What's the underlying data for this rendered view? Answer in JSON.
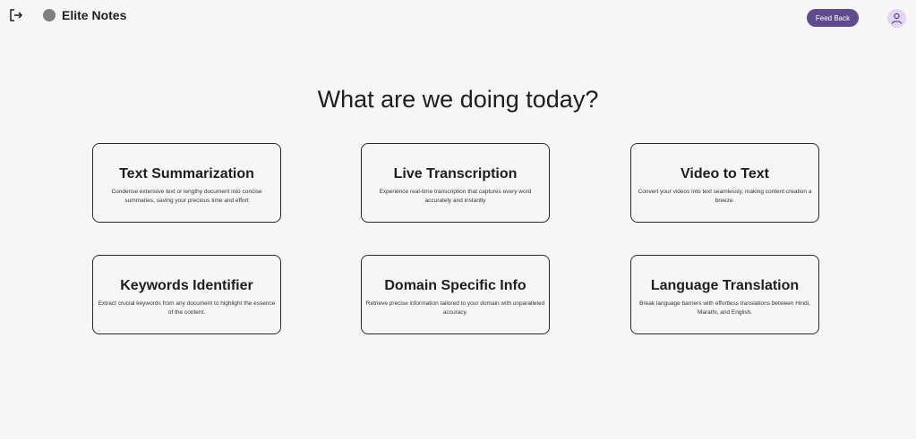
{
  "header": {
    "app_title": "Elite Notes",
    "feedback_label": "Feed Back",
    "logout_icon": "logout-icon",
    "avatar_icon": "user-icon"
  },
  "main": {
    "title": "What are we doing today?",
    "cards": [
      {
        "title": "Text Summarization",
        "description": "Condense extensive text or lengthy document into concise summaries, saving your precious time and effort"
      },
      {
        "title": "Live Transcription",
        "description": "Experience real-time transcription that captures every word accurately and instantly"
      },
      {
        "title": "Video to Text",
        "description": "Convert your videos into text seamlessly, making content creation a breeze."
      },
      {
        "title": "Keywords Identifier",
        "description": "Extract crucial keywords from any document to highlight the essence of the content."
      },
      {
        "title": "Domain Specific Info",
        "description": "Retrieve precise information tailored to your domain with unparalleled accuracy."
      },
      {
        "title": "Language Translation",
        "description": "Break language barriers with effortless translations between Hindi, Marathi, and English."
      }
    ]
  },
  "colors": {
    "background": "#f6f6f6",
    "accent": "#5e4c8f",
    "avatar_bg": "#e2d4f2",
    "logo_dot": "#808080"
  }
}
